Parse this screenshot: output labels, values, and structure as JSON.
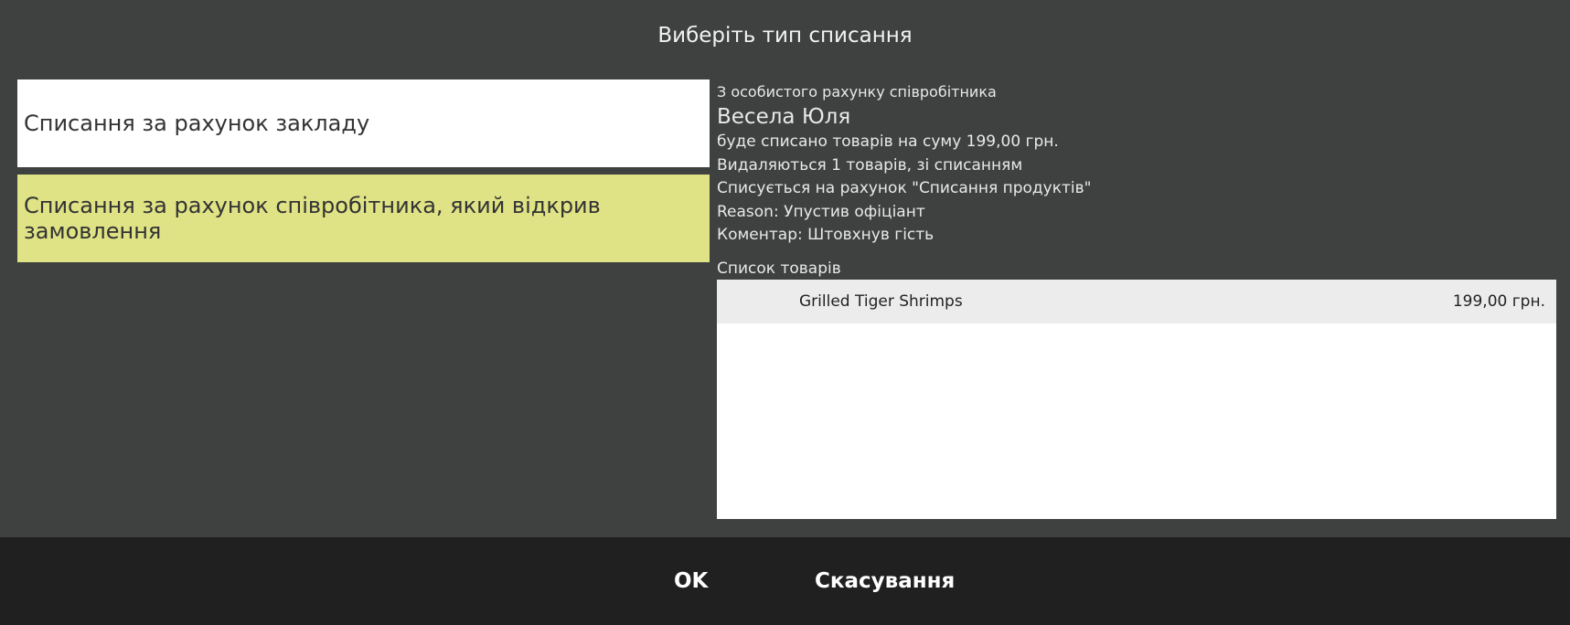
{
  "dialog": {
    "title": "Виберіть тип списання"
  },
  "options": [
    {
      "label": "Списання за рахунок закладу",
      "selected": false
    },
    {
      "label": "Списання за рахунок співробітника, який відкрив замовлення",
      "selected": true
    }
  ],
  "info": {
    "subtitle": "З особистого рахунку співробітника",
    "name": "Весела Юля",
    "amount_line": "буде списано товарів на суму 199,00 грн.",
    "removed_line": "Видаляються 1 товарів, зі списанням",
    "account_line": "Списується на рахунок \"Списання продуктів\"",
    "reason_line": "Reason: Упустив офіціант",
    "comment_line": "Коментар: Штовхнув гість"
  },
  "items": {
    "label": "Список товарів",
    "rows": [
      {
        "name": "Grilled Tiger Shrimps",
        "price": "199,00 грн."
      }
    ]
  },
  "footer": {
    "ok_label": "OK",
    "cancel_label": "Скасування"
  },
  "colors": {
    "background": "#3f4040",
    "footer": "#202020",
    "selected_option": "#dfe386",
    "option": "#ffffff"
  }
}
